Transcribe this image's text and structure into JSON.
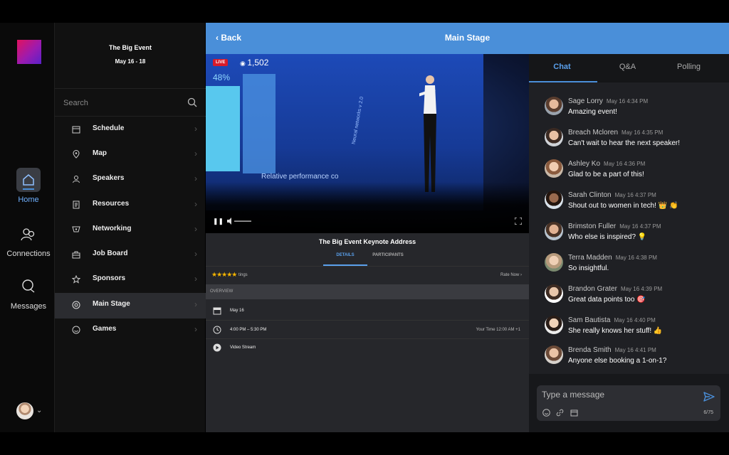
{
  "event": {
    "title": "The Big Event",
    "dates": "May 16 - 18"
  },
  "rail": {
    "items": [
      {
        "label": "Home",
        "icon": "home-icon"
      },
      {
        "label": "Connections",
        "icon": "people-icon"
      },
      {
        "label": "Messages",
        "icon": "chat-bubble-icon"
      }
    ]
  },
  "nav": {
    "search_placeholder": "Search",
    "items": [
      {
        "label": "Schedule",
        "icon": "calendar-icon"
      },
      {
        "label": "Map",
        "icon": "map-pin-icon"
      },
      {
        "label": "Speakers",
        "icon": "speaker-icon"
      },
      {
        "label": "Resources",
        "icon": "document-icon"
      },
      {
        "label": "Networking",
        "icon": "network-icon"
      },
      {
        "label": "Job Board",
        "icon": "briefcase-icon"
      },
      {
        "label": "Sponsors",
        "icon": "star-icon"
      },
      {
        "label": "Main Stage",
        "icon": "broadcast-icon"
      },
      {
        "label": "Games",
        "icon": "smiley-icon"
      }
    ]
  },
  "header": {
    "back_label": "Back",
    "title": "Main Stage"
  },
  "video": {
    "live_badge": "LIVE",
    "viewer_count": "1,502",
    "slide_percent": "48%",
    "slide_caption": "Relative performance co",
    "slide_axis": "Neural networks v 2.0"
  },
  "session": {
    "title": "The Big Event Keynote Address",
    "tabs": [
      "DETAILS",
      "PARTICIPANTS"
    ],
    "stars": "★★★★★",
    "ratings_label": "tings",
    "rate_now": "Rate Now ›",
    "overview_label": "OVERVIEW",
    "date": "May 16",
    "time": "4:00 PM – 5:30 PM",
    "your_time": "Your Time 12:00 AM +1",
    "format": "Video Stream"
  },
  "chat": {
    "tabs": [
      "Chat",
      "Q&A",
      "Polling"
    ],
    "messages": [
      {
        "name": "Sage Lorry",
        "time": "May 16 4:34 PM",
        "text": "Amazing event!"
      },
      {
        "name": "Breach Mcloren",
        "time": "May 16 4:35 PM",
        "text": "Can't wait to hear the next speaker!"
      },
      {
        "name": "Ashley Ko",
        "time": "May 16 4:36 PM",
        "text": "Glad to be a part of this!"
      },
      {
        "name": "Sarah Clinton",
        "time": "May 16 4:37 PM",
        "text": "Shout out to women in tech! 👑 👏"
      },
      {
        "name": "Brimston Fuller",
        "time": "May 16 4:37 PM",
        "text": "Who else is inspired? 💡"
      },
      {
        "name": "Terra Madden",
        "time": "May 16 4:38 PM",
        "text": "So insightful."
      },
      {
        "name": "Brandon Grater",
        "time": "May 16 4:39 PM",
        "text": "Great data points too 🎯"
      },
      {
        "name": "Sam Bautista",
        "time": "May 16 4:40 PM",
        "text": "She really knows her stuff! 👍"
      },
      {
        "name": "Brenda Smith",
        "time": "May 16 4:41 PM",
        "text": "Anyone else booking a 1-on-1?"
      }
    ],
    "composer_placeholder": "Type a message",
    "char_counter": "6/75"
  },
  "colors": {
    "accent": "#4a8fd9",
    "live": "#d81b2a",
    "star": "#f4b400"
  }
}
